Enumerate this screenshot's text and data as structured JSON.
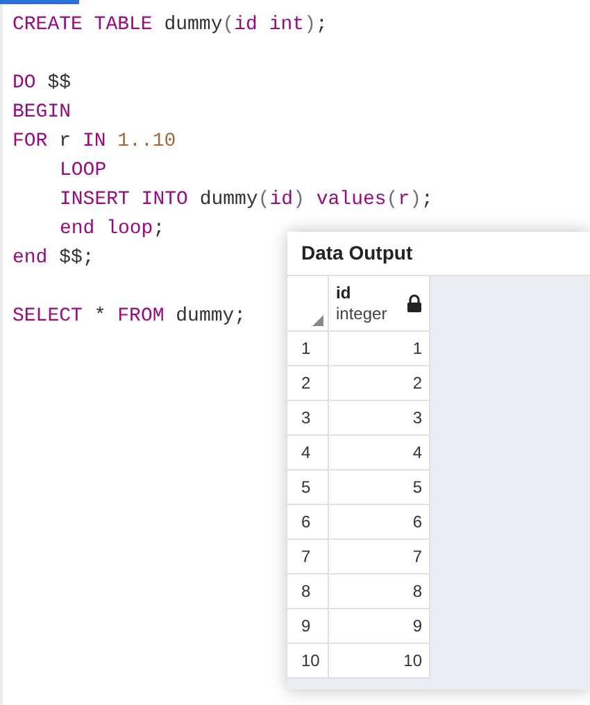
{
  "editor": {
    "blocks": [
      {
        "lines": [
          {
            "indent": false,
            "tokens": [
              {
                "text": "CREATE TABLE",
                "kind": "keyword"
              },
              {
                "text": " dummy",
                "kind": "plain"
              },
              {
                "text": "(",
                "kind": "punct"
              },
              {
                "text": "id int",
                "kind": "keyword"
              },
              {
                "text": ")",
                "kind": "punct"
              },
              {
                "text": ";",
                "kind": "plain"
              }
            ]
          }
        ]
      },
      {
        "lines": [
          {
            "indent": false,
            "tokens": [
              {
                "text": "DO",
                "kind": "keyword"
              },
              {
                "text": " $$",
                "kind": "plain"
              }
            ]
          },
          {
            "indent": false,
            "tokens": [
              {
                "text": "BEGIN",
                "kind": "keyword"
              }
            ]
          },
          {
            "indent": false,
            "tokens": [
              {
                "text": "FOR",
                "kind": "keyword"
              },
              {
                "text": " r ",
                "kind": "plain"
              },
              {
                "text": "IN",
                "kind": "keyword"
              },
              {
                "text": " 1..10",
                "kind": "number"
              }
            ]
          },
          {
            "indent": true,
            "tokens": [
              {
                "text": "LOOP",
                "kind": "keyword"
              }
            ]
          },
          {
            "indent": true,
            "tokens": [
              {
                "text": "INSERT INTO",
                "kind": "keyword"
              },
              {
                "text": " dummy",
                "kind": "plain"
              },
              {
                "text": "(",
                "kind": "punct"
              },
              {
                "text": "id",
                "kind": "keyword"
              },
              {
                "text": ") ",
                "kind": "punct"
              },
              {
                "text": "values",
                "kind": "keyword"
              },
              {
                "text": "(",
                "kind": "punct"
              },
              {
                "text": "r",
                "kind": "keyword"
              },
              {
                "text": ")",
                "kind": "punct"
              },
              {
                "text": ";",
                "kind": "plain"
              }
            ]
          },
          {
            "indent": true,
            "tokens": [
              {
                "text": "end loop",
                "kind": "keyword"
              },
              {
                "text": ";",
                "kind": "plain"
              }
            ]
          },
          {
            "indent": false,
            "tokens": [
              {
                "text": "end",
                "kind": "keyword"
              },
              {
                "text": " $$;",
                "kind": "plain"
              }
            ]
          }
        ]
      },
      {
        "lines": [
          {
            "indent": false,
            "tokens": [
              {
                "text": "SELECT",
                "kind": "keyword"
              },
              {
                "text": " * ",
                "kind": "plain"
              },
              {
                "text": "FROM",
                "kind": "keyword"
              },
              {
                "text": " dummy;",
                "kind": "plain"
              }
            ]
          }
        ]
      }
    ]
  },
  "data_output": {
    "title": "Data Output",
    "columns": [
      {
        "name": "id",
        "type": "integer",
        "locked": true
      }
    ],
    "rows": [
      [
        "1",
        "1"
      ],
      [
        "2",
        "2"
      ],
      [
        "3",
        "3"
      ],
      [
        "4",
        "4"
      ],
      [
        "5",
        "5"
      ],
      [
        "6",
        "6"
      ],
      [
        "7",
        "7"
      ],
      [
        "8",
        "8"
      ],
      [
        "9",
        "9"
      ],
      [
        "10",
        "10"
      ]
    ]
  }
}
